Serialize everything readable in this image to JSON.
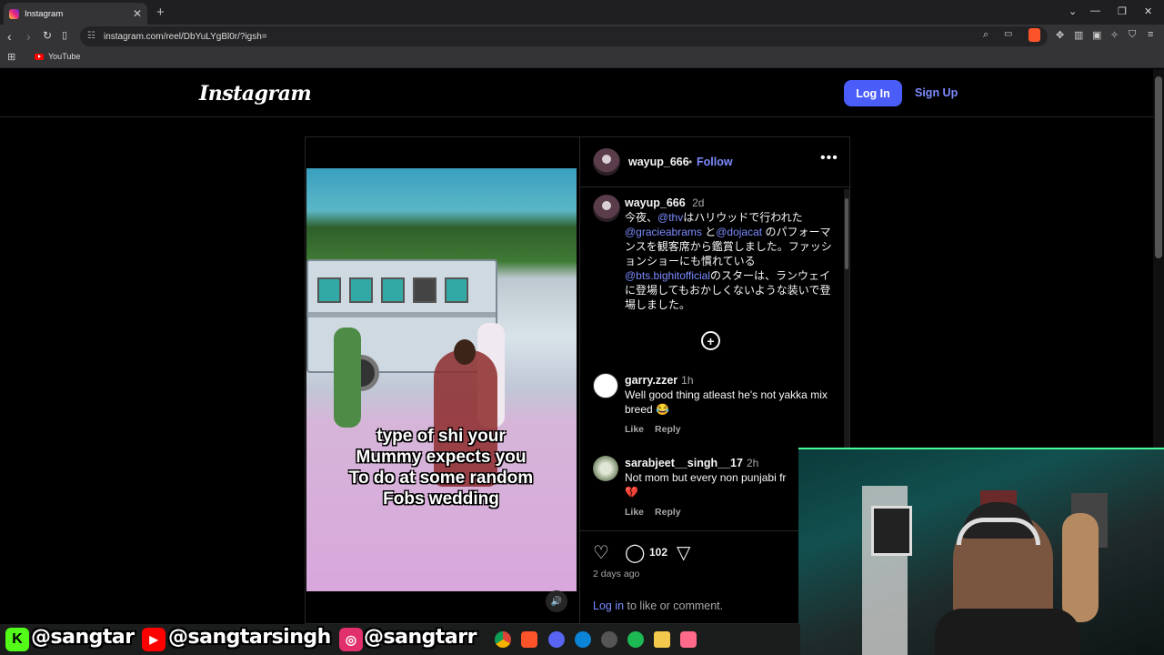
{
  "browser": {
    "tab_title": "Instagram",
    "tab_close": "✕",
    "new_tab": "+",
    "url": "instagram.com/reel/DbYuLYgBl0r/?igsh=",
    "bookmark_youtube": "YouTube",
    "window_controls": [
      "⌄",
      "—",
      "❐",
      "✕"
    ]
  },
  "header": {
    "logo": "Instagram",
    "login_label": "Log In",
    "signup_label": "Sign Up"
  },
  "video": {
    "caption_lines": [
      "type of shi your",
      "Mummy expects you",
      "To do at some random",
      "Fobs wedding"
    ]
  },
  "post": {
    "username": "wayup_666",
    "follow_label": "Follow",
    "separator": "•",
    "more": "•••",
    "caption": {
      "username": "wayup_666",
      "time": "2d",
      "text_1": "今夜、",
      "mention_1": "@thv",
      "text_2": "はハリウッドで行われた",
      "mention_2": "@gracieabrams",
      "text_3": " と",
      "mention_3": "@dojacat",
      "text_4": " のパフォーマンスを観客席から鑑賞しました。ファッションショーにも慣れている",
      "mention_4": "@bts.bighitofficial",
      "text_5": "のスターは、ランウェイに登場してもおかしくないような装いで登場しました。"
    },
    "load_more": "+",
    "comments": [
      {
        "username": "garry.zzer",
        "time": "1h",
        "text": "Well good thing atleast he's not yakka mix breed 😂",
        "like": "Like",
        "reply": "Reply"
      },
      {
        "username": "sarabjeet__singh__17",
        "time": "2h",
        "text": "Not mom but every non punjabi fr",
        "emoji": "💔",
        "like": "Like",
        "reply": "Reply"
      }
    ],
    "comment_count": "102",
    "posted_ago": "2 days ago",
    "login_link": "Log in",
    "login_suffix": " to like or comment."
  },
  "overlay": {
    "kick_handle": "@sangtar",
    "youtube_handle": "@sangtarsingh",
    "instagram_handle": "@sangtarr",
    "colors": {
      "kick": "#53fc18",
      "youtube": "#ff0000",
      "instagram": "#e1306c"
    }
  }
}
